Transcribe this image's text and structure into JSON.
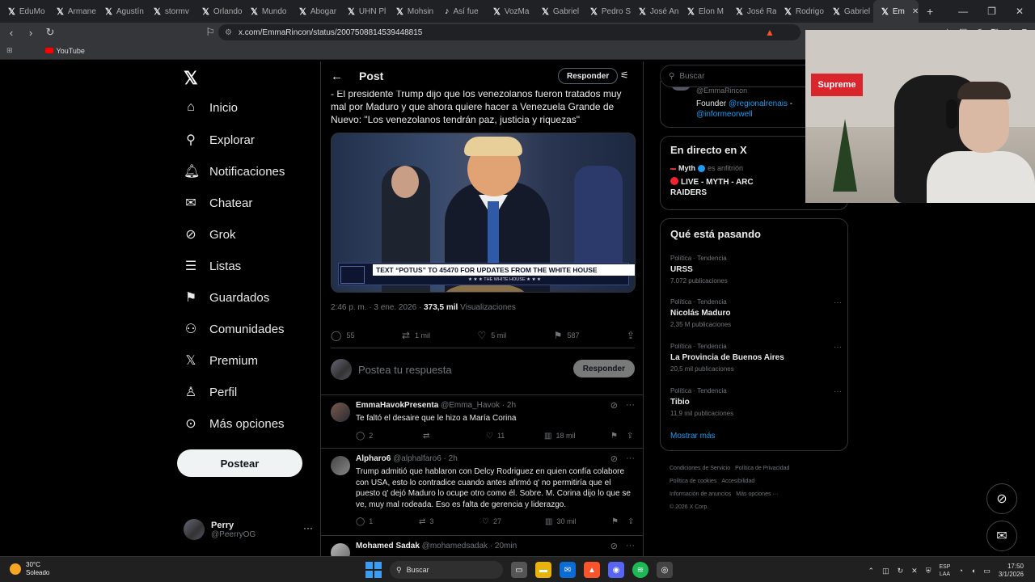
{
  "browser": {
    "tabs": [
      "EduMo",
      "Armane",
      "Agustín",
      "stormv",
      "Orlando",
      "Mundo",
      "Abogar",
      "UHN Pl",
      "Mohsin",
      "Así fue",
      "VozMa",
      "Gabriel",
      "Pedro S",
      "José An",
      "Elon M",
      "José Ra",
      "Rodrigo",
      "Gabriel",
      "Em"
    ],
    "new_tab": "+",
    "url": "x.com/EmmaRincon/status/2007508814539448815",
    "bookmark_youtube": "YouTube"
  },
  "nav": {
    "items": [
      {
        "icon": "home-icon",
        "label": "Inicio"
      },
      {
        "icon": "search-icon",
        "label": "Explorar"
      },
      {
        "icon": "bell-icon",
        "label": "Notificaciones"
      },
      {
        "icon": "mail-icon",
        "label": "Chatear"
      },
      {
        "icon": "grok-icon",
        "label": "Grok"
      },
      {
        "icon": "list-icon",
        "label": "Listas"
      },
      {
        "icon": "bookmark-icon",
        "label": "Guardados"
      },
      {
        "icon": "people-icon",
        "label": "Comunidades"
      },
      {
        "icon": "x-icon",
        "label": "Premium"
      },
      {
        "icon": "person-icon",
        "label": "Perfil"
      },
      {
        "icon": "more-icon",
        "label": "Más opciones"
      }
    ],
    "post_button": "Postear",
    "user": {
      "name": "Perry",
      "handle": "@PeerryOG"
    }
  },
  "main": {
    "header_title": "Post",
    "reply_header_button": "Responder",
    "post_text": "- El presidente Trump dijo que los venezolanos fueron tratados muy mal por Maduro y que ahora quiere hacer a Venezuela Grande de Nuevo: \"Los venezolanos tendrán paz, justicia y riquezas\"",
    "media_banner": "TEXT “POTUS” TO 45470 FOR UPDATES FROM THE WHITE HOUSE",
    "media_banner_sub": "★ ★ ★   THE WHITE HOUSE   ★ ★ ★",
    "meta_time": "2:46 p. m. · 3 ene. 2026 · ",
    "meta_views": "373,5 mil",
    "meta_views_label": " Visualizaciones",
    "actions": {
      "replies": "55",
      "reposts": "1 mil",
      "likes": "5 mil",
      "bookmarks": "587"
    },
    "compose_placeholder": "Postea tu respuesta",
    "compose_button": "Responder",
    "replies": [
      {
        "name": "EmmaHavokPresenta",
        "handle": "@Emma_Havok · 2h",
        "text": "Te faltó el desaire que le hizo a María Corina",
        "replies": "2",
        "reposts": "",
        "likes": "11",
        "views": "18 mil"
      },
      {
        "name": "Alpharo6",
        "handle": "@alphalfaro6 · 2h",
        "text": "Trump admitió que hablaron con Delcy Rodriguez en quien confía colabore con USA, esto lo contradice cuando antes afirmó q' no permitiría que el puesto q' dejó Maduro lo ocupe otro como él. Sobre. M. Corina dijo lo que se ve, muy mal rodeada. Eso es falta de gerencia y liderazgo.",
        "replies": "1",
        "reposts": "3",
        "likes": "27",
        "views": "30 mil"
      },
      {
        "name": "Mohamed Sadak",
        "handle": "@mohamedsadak · 20min",
        "text": "",
        "replies": "",
        "reposts": "",
        "likes": "",
        "views": ""
      }
    ]
  },
  "right": {
    "search_placeholder": "Buscar",
    "profile": {
      "handle": "@EmmaRincon",
      "bio_prefix": "Founder ",
      "bio_link1": "@regionalrenais",
      "bio_sep": " - ",
      "bio_link2": "@informeorwell"
    },
    "live": {
      "title": "En directo en X",
      "host": "Myth",
      "host_suffix": "es anfitrión",
      "stream": "LIVE - MYTH - ARC RAIDERS"
    },
    "trending": {
      "title": "Qué está pasando",
      "items": [
        {
          "category": "Política · Tendencia",
          "name": "URSS",
          "count": "7.072 publicaciones"
        },
        {
          "category": "Política · Tendencia",
          "name": "Nicolás Maduro",
          "count": "2,35 M publicaciones"
        },
        {
          "category": "Política · Tendencia",
          "name": "La Provincia de Buenos Aires",
          "count": "20,5 mil publicaciones"
        },
        {
          "category": "Política · Tendencia",
          "name": "Tibio",
          "count": "11,9 mil publicaciones"
        }
      ],
      "show_more": "Mostrar más"
    },
    "footer": [
      "Condiciones de Servicio",
      "Política de Privacidad",
      "Política de cookies",
      "Accesibilidad",
      "Información de anuncios",
      "Más opciones ···",
      "© 2026 X Corp."
    ]
  },
  "webcam": {
    "sign": "Supreme"
  },
  "taskbar": {
    "temp": "30°C",
    "condition": "Soleado",
    "search": "Buscar",
    "lang1": "ESP",
    "lang2": "LAA",
    "time": "17:50",
    "date": "3/1/2026"
  }
}
